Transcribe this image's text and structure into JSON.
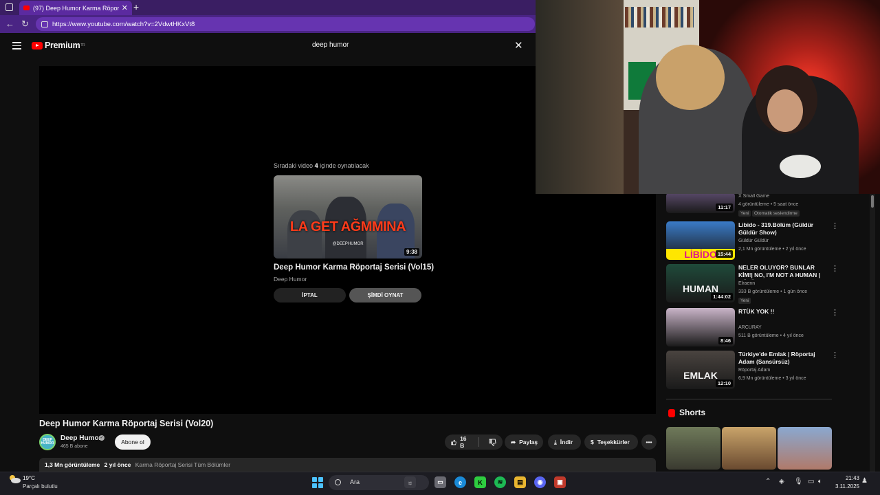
{
  "browser": {
    "tab_title": "(97) Deep Humor Karma Röportaj",
    "new_tab_glyph": "+",
    "close_tab_glyph": "✕",
    "url": "https://www.youtube.com/watch?v=2VdwtHKxVt8"
  },
  "youtube": {
    "logo_text": "Premium",
    "logo_region": "TR",
    "search_value": "deep humor"
  },
  "player": {
    "upnext_prefix": "Sıradaki video",
    "upnext_seconds": "4",
    "upnext_suffix": "içinde oynatılacak",
    "thumb_overlay": "LA GET AĞMMINA",
    "thumb_watermark": "@DEEPHUMOR",
    "thumb_duration": "9:38",
    "upnext_title": "Deep Humor Karma Röportaj Serisi (Vol15)",
    "upnext_channel": "Deep Humor",
    "cancel_label": "İPTAL",
    "play_now_label": "ŞİMDİ OYNAT"
  },
  "video": {
    "title": "Deep Humor Karma Röportaj Serisi (Vol20)",
    "channel_name": "Deep Humor",
    "avatar_text": "DEEP HUMOR",
    "subscribers": "465 B abone",
    "subscribe_label": "Abone ol",
    "likes": "16 B",
    "share_label": "Paylaş",
    "download_label": "İndir",
    "thanks_label": "Teşekkürler",
    "views": "1,3 Mn görüntüleme",
    "age": "2 yıl önce",
    "playlist_tag": "Karma Röportaj Serisi Tüm Bölümler"
  },
  "recommendations": [
    {
      "title": "",
      "channel": "X Small Game",
      "meta": "4 görüntüleme • 5 saat önce",
      "badges": [
        "Yeni",
        "Otomatik seslendirme"
      ],
      "duration": "11:17",
      "thumb_text": "",
      "thumb_color": "#5a4a6a"
    },
    {
      "title": "Libido - 319.Bölüm (Güldür Güldür Show)",
      "channel": "Güldür Güldür",
      "meta": "2,1 Mn görüntüleme • 2 yıl önce",
      "badges": [],
      "duration": "15:44",
      "thumb_text": "LİBİDO",
      "thumb_color": "#3a7bc8"
    },
    {
      "title": "NELER OLUYOR? BUNLAR KİM!| NO, I'M NOT A HUMAN | BÖLÜ...",
      "channel": "Elraenn",
      "meta": "333 B görüntüleme • 1 gün önce",
      "badges": [
        "Yeni"
      ],
      "duration": "1:44:02",
      "thumb_text": "HUMAN",
      "thumb_color": "#1f4a3a"
    },
    {
      "title": "RTÜK YOK !!",
      "channel": "ARCURAY",
      "meta": "511 B görüntüleme • 4 yıl önce",
      "badges": [],
      "duration": "8:46",
      "thumb_text": "",
      "thumb_color": "#c9b4c8"
    },
    {
      "title": "Türkiye'de Emlak | Röportaj Adam (Sansürsüz)",
      "channel": "Röportaj Adam",
      "meta": "6,9 Mn görüntüleme • 3 yıl önce",
      "badges": [],
      "duration": "12:10",
      "thumb_text": "EMLAK",
      "thumb_color": "#4a4440"
    }
  ],
  "shorts": {
    "title": "Shorts"
  },
  "taskbar": {
    "temperature": "19°C",
    "weather": "Parçalı bulutlu",
    "search_label": "Ara",
    "time": "21:43",
    "date": "3.11.2025"
  }
}
